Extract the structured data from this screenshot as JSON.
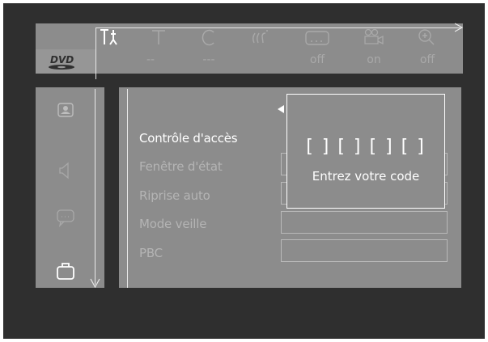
{
  "top_menu": {
    "icons": [
      {
        "name": "setup-tools-icon",
        "active": true
      },
      {
        "name": "subtitle-t-icon",
        "active": false
      },
      {
        "name": "chapter-c-icon",
        "active": false
      },
      {
        "name": "sound-waves-icon",
        "active": false
      },
      {
        "name": "caption-box-icon",
        "active": false
      },
      {
        "name": "camera-angle-icon",
        "active": false
      },
      {
        "name": "zoom-icon",
        "active": false
      }
    ],
    "source_label": "DVD",
    "values": [
      "--",
      "---",
      "off",
      "on",
      "off"
    ]
  },
  "sidebar": {
    "icons": [
      "picture-icon",
      "speaker-icon",
      "speech-bubble-icon",
      "preferences-briefcase-icon"
    ]
  },
  "menu": {
    "items": [
      {
        "label": "Contrôle d'accès",
        "active": true
      },
      {
        "label": "Fenêtre d'état",
        "active": false
      },
      {
        "label": "Riprise auto",
        "active": false
      },
      {
        "label": "Mode veille",
        "active": false
      },
      {
        "label": "PBC",
        "active": false
      }
    ]
  },
  "popup": {
    "code": "[ ] [ ] [ ] [ ]",
    "hint": "Entrez votre code"
  },
  "colors": {
    "screen_bg": "#2f2f2f",
    "panel_bg": "#8c8c8c",
    "highlight_text": "#ffffff",
    "dim_text": "#b4b4b4"
  }
}
